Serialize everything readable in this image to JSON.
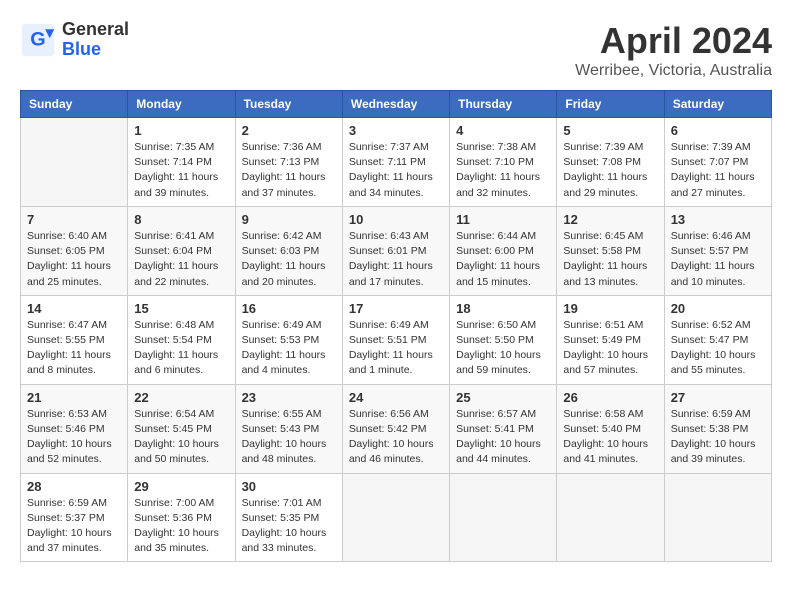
{
  "header": {
    "logo_line1": "General",
    "logo_line2": "Blue",
    "month": "April 2024",
    "location": "Werribee, Victoria, Australia"
  },
  "weekdays": [
    "Sunday",
    "Monday",
    "Tuesday",
    "Wednesday",
    "Thursday",
    "Friday",
    "Saturday"
  ],
  "weeks": [
    [
      {
        "day": "",
        "info": ""
      },
      {
        "day": "1",
        "info": "Sunrise: 7:35 AM\nSunset: 7:14 PM\nDaylight: 11 hours\nand 39 minutes."
      },
      {
        "day": "2",
        "info": "Sunrise: 7:36 AM\nSunset: 7:13 PM\nDaylight: 11 hours\nand 37 minutes."
      },
      {
        "day": "3",
        "info": "Sunrise: 7:37 AM\nSunset: 7:11 PM\nDaylight: 11 hours\nand 34 minutes."
      },
      {
        "day": "4",
        "info": "Sunrise: 7:38 AM\nSunset: 7:10 PM\nDaylight: 11 hours\nand 32 minutes."
      },
      {
        "day": "5",
        "info": "Sunrise: 7:39 AM\nSunset: 7:08 PM\nDaylight: 11 hours\nand 29 minutes."
      },
      {
        "day": "6",
        "info": "Sunrise: 7:39 AM\nSunset: 7:07 PM\nDaylight: 11 hours\nand 27 minutes."
      }
    ],
    [
      {
        "day": "7",
        "info": "Sunrise: 6:40 AM\nSunset: 6:05 PM\nDaylight: 11 hours\nand 25 minutes."
      },
      {
        "day": "8",
        "info": "Sunrise: 6:41 AM\nSunset: 6:04 PM\nDaylight: 11 hours\nand 22 minutes."
      },
      {
        "day": "9",
        "info": "Sunrise: 6:42 AM\nSunset: 6:03 PM\nDaylight: 11 hours\nand 20 minutes."
      },
      {
        "day": "10",
        "info": "Sunrise: 6:43 AM\nSunset: 6:01 PM\nDaylight: 11 hours\nand 17 minutes."
      },
      {
        "day": "11",
        "info": "Sunrise: 6:44 AM\nSunset: 6:00 PM\nDaylight: 11 hours\nand 15 minutes."
      },
      {
        "day": "12",
        "info": "Sunrise: 6:45 AM\nSunset: 5:58 PM\nDaylight: 11 hours\nand 13 minutes."
      },
      {
        "day": "13",
        "info": "Sunrise: 6:46 AM\nSunset: 5:57 PM\nDaylight: 11 hours\nand 10 minutes."
      }
    ],
    [
      {
        "day": "14",
        "info": "Sunrise: 6:47 AM\nSunset: 5:55 PM\nDaylight: 11 hours\nand 8 minutes."
      },
      {
        "day": "15",
        "info": "Sunrise: 6:48 AM\nSunset: 5:54 PM\nDaylight: 11 hours\nand 6 minutes."
      },
      {
        "day": "16",
        "info": "Sunrise: 6:49 AM\nSunset: 5:53 PM\nDaylight: 11 hours\nand 4 minutes."
      },
      {
        "day": "17",
        "info": "Sunrise: 6:49 AM\nSunset: 5:51 PM\nDaylight: 11 hours\nand 1 minute."
      },
      {
        "day": "18",
        "info": "Sunrise: 6:50 AM\nSunset: 5:50 PM\nDaylight: 10 hours\nand 59 minutes."
      },
      {
        "day": "19",
        "info": "Sunrise: 6:51 AM\nSunset: 5:49 PM\nDaylight: 10 hours\nand 57 minutes."
      },
      {
        "day": "20",
        "info": "Sunrise: 6:52 AM\nSunset: 5:47 PM\nDaylight: 10 hours\nand 55 minutes."
      }
    ],
    [
      {
        "day": "21",
        "info": "Sunrise: 6:53 AM\nSunset: 5:46 PM\nDaylight: 10 hours\nand 52 minutes."
      },
      {
        "day": "22",
        "info": "Sunrise: 6:54 AM\nSunset: 5:45 PM\nDaylight: 10 hours\nand 50 minutes."
      },
      {
        "day": "23",
        "info": "Sunrise: 6:55 AM\nSunset: 5:43 PM\nDaylight: 10 hours\nand 48 minutes."
      },
      {
        "day": "24",
        "info": "Sunrise: 6:56 AM\nSunset: 5:42 PM\nDaylight: 10 hours\nand 46 minutes."
      },
      {
        "day": "25",
        "info": "Sunrise: 6:57 AM\nSunset: 5:41 PM\nDaylight: 10 hours\nand 44 minutes."
      },
      {
        "day": "26",
        "info": "Sunrise: 6:58 AM\nSunset: 5:40 PM\nDaylight: 10 hours\nand 41 minutes."
      },
      {
        "day": "27",
        "info": "Sunrise: 6:59 AM\nSunset: 5:38 PM\nDaylight: 10 hours\nand 39 minutes."
      }
    ],
    [
      {
        "day": "28",
        "info": "Sunrise: 6:59 AM\nSunset: 5:37 PM\nDaylight: 10 hours\nand 37 minutes."
      },
      {
        "day": "29",
        "info": "Sunrise: 7:00 AM\nSunset: 5:36 PM\nDaylight: 10 hours\nand 35 minutes."
      },
      {
        "day": "30",
        "info": "Sunrise: 7:01 AM\nSunset: 5:35 PM\nDaylight: 10 hours\nand 33 minutes."
      },
      {
        "day": "",
        "info": ""
      },
      {
        "day": "",
        "info": ""
      },
      {
        "day": "",
        "info": ""
      },
      {
        "day": "",
        "info": ""
      }
    ]
  ]
}
